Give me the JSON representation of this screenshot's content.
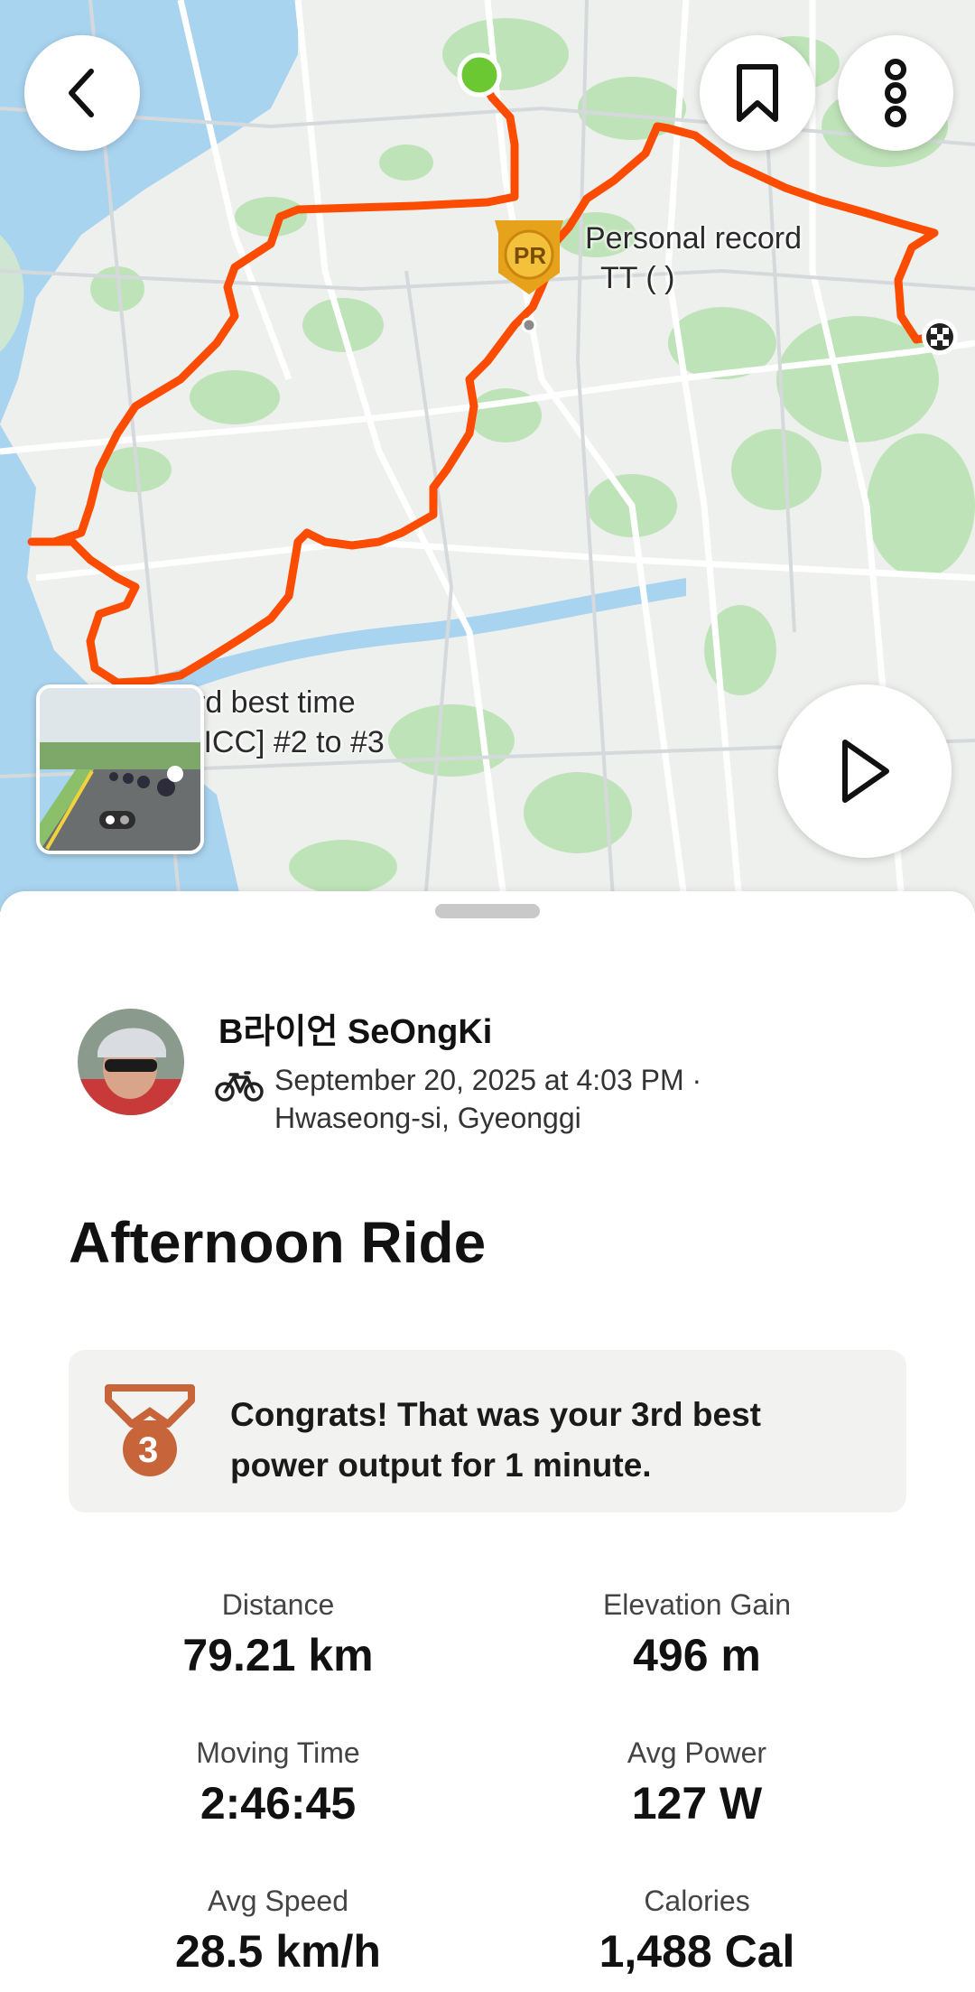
{
  "map": {
    "pr_label_title": "Personal record",
    "pr_label_segment": "TT   (       )",
    "best_time_label": "rd best time",
    "rank_label": "[ICC]     #2 to #3",
    "pr_badge_text": "PR",
    "route_color": "#fc4c02",
    "start_color": "#6cc832"
  },
  "athlete": {
    "name": "B라이언 SeOngKi",
    "meta_line1": "September 20, 2025 at 4:03 PM ·",
    "meta_line2": "Hwaseong-si, Gyeonggi"
  },
  "activity": {
    "title": "Afternoon Ride"
  },
  "achievement": {
    "text": "Congrats! That was your 3rd best power output for 1 minute.",
    "medal_rank": "3",
    "medal_color": "#c8643a"
  },
  "stats": [
    {
      "label": "Distance",
      "value": "79.21 km"
    },
    {
      "label": "Elevation Gain",
      "value": "496 m"
    },
    {
      "label": "Moving Time",
      "value": "2:46:45"
    },
    {
      "label": "Avg Power",
      "value": "127 W"
    },
    {
      "label": "Avg Speed",
      "value": "28.5 km/h"
    },
    {
      "label": "Calories",
      "value": "1,488 Cal"
    }
  ]
}
